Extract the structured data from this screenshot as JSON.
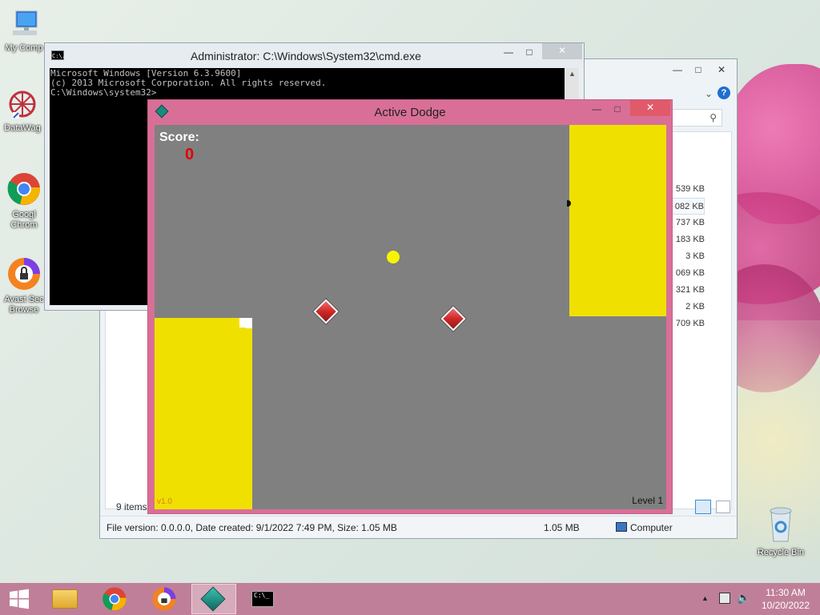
{
  "desktop": {
    "icons": [
      {
        "name": "my-computer",
        "label": "My Comp"
      },
      {
        "name": "datawag",
        "label": "DataWag"
      },
      {
        "name": "google-chrome",
        "label": "Googl\nChrom"
      },
      {
        "name": "avast-browser",
        "label": "Avast Sec\nBrowse"
      },
      {
        "name": "recycle-bin",
        "label": "Recycle Bin"
      }
    ]
  },
  "cmd": {
    "title": "Administrator: C:\\Windows\\System32\\cmd.exe",
    "lines": [
      "Microsoft Windows [Version 6.3.9600]",
      "(c) 2013 Microsoft Corporation. All rights reserved.",
      "C:\\Windows\\system32>"
    ],
    "icon_label": "C:\\."
  },
  "explorer": {
    "sizes": [
      "539 KB",
      "082 KB",
      "737 KB",
      "183 KB",
      "3 KB",
      "069 KB",
      "321 KB",
      "2 KB",
      "709 KB"
    ],
    "items_count": "9 items",
    "status_details": "File version: 0.0.0.0, Date created: 9/1/2022 7:49 PM, Size: 1.05 MB",
    "status_size": "1.05 MB",
    "status_location": "Computer"
  },
  "game": {
    "title": "Active Dodge",
    "score_label": "Score:",
    "score_value": "0",
    "version": "v1.0",
    "level": "Level 1",
    "colors": {
      "background": "#808080",
      "block": "#f0e000",
      "score": "#e00000",
      "orb": "#f8f400",
      "enemy": "#d02828"
    }
  },
  "taskbar": {
    "time": "11:30 AM",
    "date": "10/20/2022",
    "items": [
      "file-explorer",
      "google-chrome",
      "avast-browser",
      "active-dodge",
      "command-prompt"
    ]
  }
}
